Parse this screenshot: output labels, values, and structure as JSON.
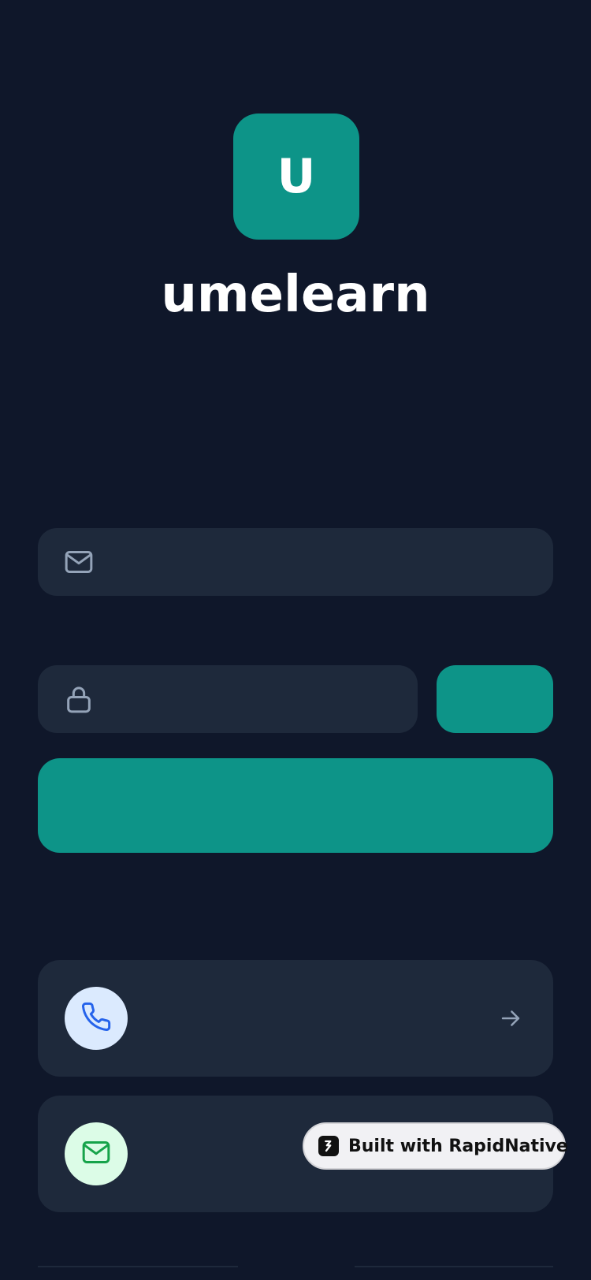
{
  "app": {
    "logo_letter": "U",
    "brand_name": "umelearn"
  },
  "form": {
    "email": {
      "value": "",
      "placeholder": "",
      "icon": "mail-icon"
    },
    "password": {
      "value": "",
      "placeholder": "",
      "icon": "lock-icon"
    },
    "show_label": "",
    "login_label": ""
  },
  "options": [
    {
      "label": "",
      "icon": "phone-icon",
      "trailing_icon": "arrow-right-icon"
    },
    {
      "label": "",
      "icon": "mail-icon"
    }
  ],
  "badge": {
    "text": "Built with RapidNative",
    "icon": "rapidnative-logo-icon"
  },
  "colors": {
    "background": "#0f172a",
    "surface": "#1e293b",
    "accent": "#0d9488",
    "icon_muted": "#94a3b8",
    "phone_bg": "#dbeafe",
    "phone_fg": "#2563eb",
    "mail_bg": "#dcfce7",
    "mail_fg": "#16a34a"
  }
}
